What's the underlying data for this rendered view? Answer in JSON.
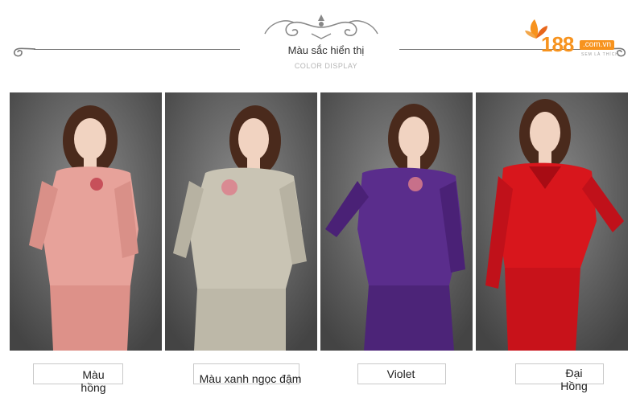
{
  "header": {
    "title": "Màu sắc hiển thị",
    "subtitle": "COLOR DISPLAY"
  },
  "logo": {
    "number": "188",
    "domain": ".com.vn",
    "tagline": "SEM LÀ THÍCH"
  },
  "products": [
    {
      "label_line1": "Màu",
      "label_line2": "hồng",
      "color": "#e7a29a",
      "shade": "#c9786e"
    },
    {
      "label_line1": "Màu xanh ngọc đậm",
      "label_line2": "",
      "color": "#c9c4b4",
      "shade": "#9c9786"
    },
    {
      "label_line1": "Violet",
      "label_line2": "",
      "color": "#5a2d8c",
      "shade": "#3a1a64"
    },
    {
      "label_line1": "Đại",
      "label_line2": "Hồng",
      "color": "#d8161c",
      "shade": "#9a0a10"
    }
  ]
}
